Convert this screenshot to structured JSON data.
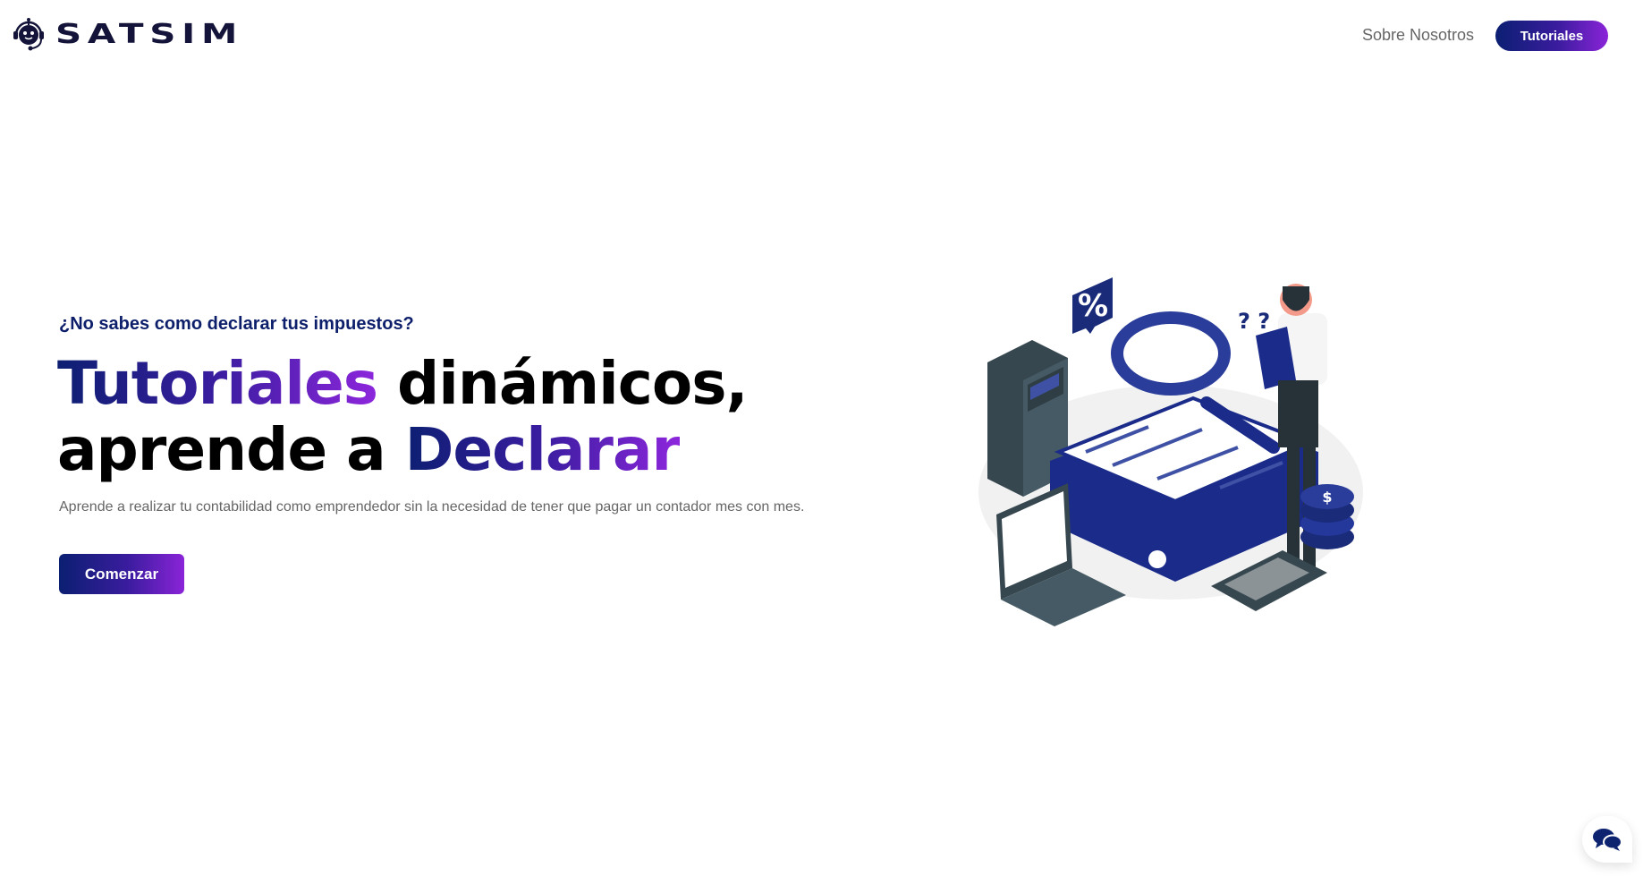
{
  "header": {
    "logo_text": "SATSIM",
    "nav": {
      "about_label": "Sobre Nosotros",
      "tutorials_label": "Tutoriales"
    }
  },
  "hero": {
    "eyebrow": "¿No sabes como declarar tus impuestos?",
    "title": {
      "highlight1": "Tutoriales",
      "rest1": " dinámicos,",
      "rest2": "aprende a ",
      "highlight2": "Declarar"
    },
    "description": "Aprende a realizar tu contabilidad como emprendedor sin la necesidad de tener que pagar un contador mes con mes.",
    "cta_label": "Comenzar"
  },
  "illustration": {
    "percent_symbol": "%",
    "question_marks": "? ?",
    "coin_symbol": "$"
  },
  "chat_widget": {
    "icon": "chat-bubbles-icon"
  },
  "colors": {
    "brand_dark": "#0b1f72",
    "brand_purple": "#8a24d8",
    "text_gray": "#666666"
  }
}
